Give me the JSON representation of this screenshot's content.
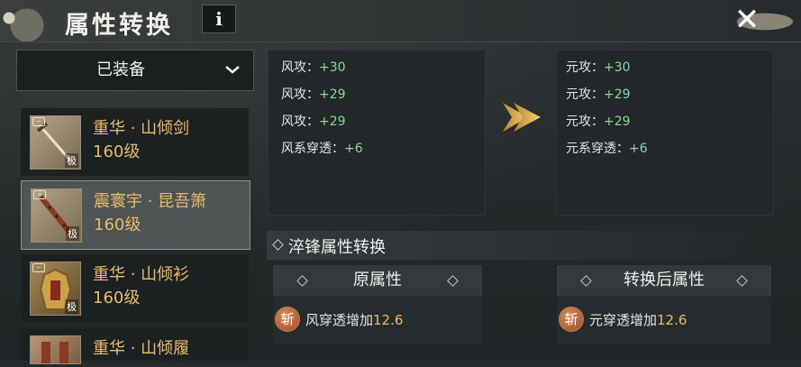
{
  "header": {
    "title": "属性转换",
    "info_label": "i",
    "close_label": "✕"
  },
  "filter": {
    "selected": "已装备"
  },
  "equipment": [
    {
      "name": "重华 · 山倾剑",
      "level": "160级",
      "rank": "极",
      "selected": false
    },
    {
      "name": "震寰宇 · 昆吾箫",
      "level": "160级",
      "rank": "极",
      "selected": true
    },
    {
      "name": "重华 · 山倾衫",
      "level": "160级",
      "rank": "极",
      "selected": false
    },
    {
      "name": "重华 · 山倾履",
      "level": "",
      "rank": "",
      "selected": false
    }
  ],
  "original_stats": [
    {
      "label": "风攻：",
      "value": "+30"
    },
    {
      "label": "风攻：",
      "value": "+29"
    },
    {
      "label": "风攻：",
      "value": "+29"
    },
    {
      "label": "风系穿透：",
      "value": "+6"
    }
  ],
  "converted_stats": [
    {
      "label": "元攻：",
      "value": "+30"
    },
    {
      "label": "元攻：",
      "value": "+29"
    },
    {
      "label": "元攻：",
      "value": "+29"
    },
    {
      "label": "元系穿透：",
      "value": "+6"
    }
  ],
  "quench": {
    "title": "淬锋属性转换",
    "original_header": "原属性",
    "converted_header": "转换后属性",
    "badge": "斩",
    "original_text": "风穿透增加",
    "original_value": "12.6",
    "converted_text": "元穿透增加",
    "converted_value": "12.6"
  },
  "colors": {
    "gold": "#e9ba6a",
    "green": "#8fd69a"
  }
}
